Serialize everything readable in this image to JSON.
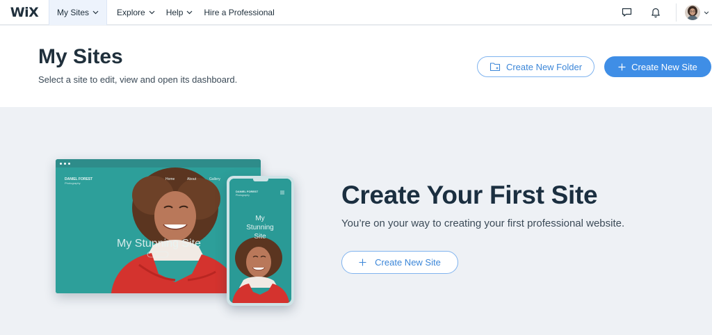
{
  "app": {
    "logo": "WiX"
  },
  "nav": {
    "my_sites": "My Sites",
    "explore": "Explore",
    "help": "Help",
    "hire": "Hire a Professional"
  },
  "header": {
    "title": "My Sites",
    "subtitle": "Select a site to edit, view and open its dashboard.",
    "create_folder": "Create New Folder",
    "create_site": "Create New Site"
  },
  "hero": {
    "title": "Create Your First Site",
    "text": "You’re on your way to creating your first professional website.",
    "button": "Create New Site"
  },
  "mockup": {
    "brand": "DANIEL FOREST",
    "brand_sub": "Photography",
    "nav_home": "Home",
    "nav_about": "About",
    "nav_gallery": "Gallery",
    "desktop_headline": "My Stunning Site",
    "phone_headline_1": "My",
    "phone_headline_2": "Stunning",
    "phone_headline_3": "Site"
  },
  "colors": {
    "accent": "#3f8ee6",
    "text_dark": "#20303c",
    "teal": "#2a9a96"
  },
  "icons": [
    "chevron-down-icon",
    "chat-icon",
    "bell-icon",
    "folder-plus-icon",
    "plus-icon"
  ]
}
